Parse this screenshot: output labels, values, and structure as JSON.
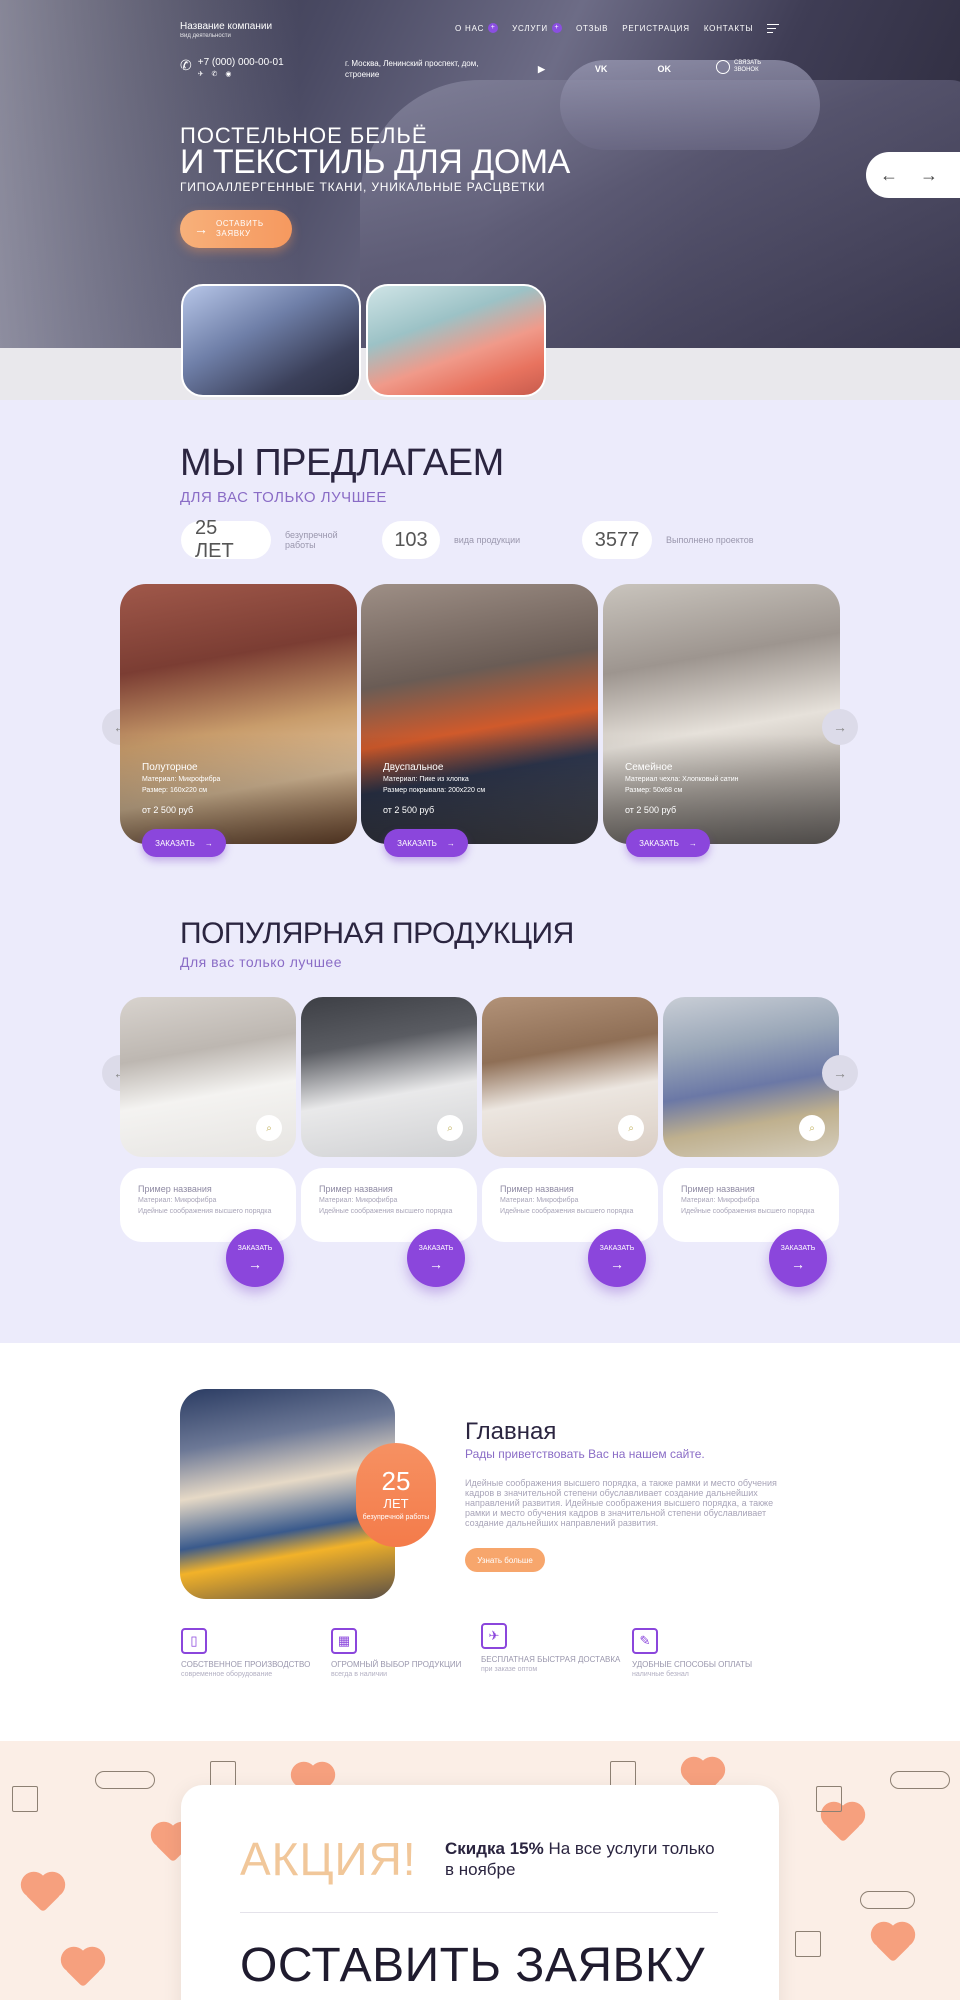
{
  "header": {
    "company_name": "Название компании",
    "company_sub": "Вид деятельности",
    "nav": [
      {
        "label": "О НАС",
        "has_dropdown": true
      },
      {
        "label": "УСЛУГИ",
        "has_dropdown": true
      },
      {
        "label": "ОТЗЫВ",
        "has_dropdown": false
      },
      {
        "label": "РЕГИСТРАЦИЯ",
        "has_dropdown": false
      },
      {
        "label": "КОНТАКТЫ",
        "has_dropdown": false
      }
    ],
    "dropdown_glyph": "+",
    "phone": "+7 (000) 000-00-01",
    "messengers": "✈ ✆ ◉",
    "address": "г. Москва, Ленинский проспект, дом, строение",
    "socials": [
      "▶",
      "VK",
      "OK"
    ],
    "call_me": "СВЯЗАТЬ ЗВОНОК"
  },
  "hero": {
    "title_line1": "ПОСТЕЛЬНОЕ БЕЛЬЁ",
    "title_line2": "И ТЕКСТИЛЬ ДЛЯ ДОМА",
    "subtitle": "ГИПОАЛЛЕРГЕННЫЕ ТКАНИ, УНИКАЛЬНЫЕ РАСЦВЕТКИ",
    "cta_line1": "ОСТАВИТЬ",
    "cta_line2": "ЗАЯВКУ",
    "arrow_prev": "←",
    "arrow_next": "→"
  },
  "offer": {
    "title": "МЫ ПРЕДЛАГАЕМ",
    "subtitle": "ДЛЯ ВАС ТОЛЬКО ЛУЧШЕЕ",
    "stats": [
      {
        "value": "25 ЛЕТ",
        "label": "безупречной работы"
      },
      {
        "value": "103",
        "label": "вида продукции"
      },
      {
        "value": "3577",
        "label": "Выполнено проектов"
      }
    ],
    "cards": [
      {
        "title": "Полуторное",
        "line1": "Материал: Микрофибра",
        "line2": "Размер: 160х220 см",
        "price": "от 2 500 руб",
        "button": "ЗАКАЗАТЬ"
      },
      {
        "title": "Двуспальное",
        "line1": "Материал: Пике из хлопка",
        "line2": "Размер покрывала: 200х220 см",
        "price": "от 2 500 руб",
        "button": "ЗАКАЗАТЬ"
      },
      {
        "title": "Семейное",
        "line1": "Материал чехла: Хлопковый сатин",
        "line2": "Размер: 50х68 см",
        "price": "от 2 500 руб",
        "button": "ЗАКАЗАТЬ"
      }
    ],
    "arrow_prev": "←",
    "arrow_next": "→",
    "button_arrow": "→"
  },
  "popular": {
    "title": "ПОПУЛЯРНАЯ ПРОДУКЦИЯ",
    "subtitle": "Для вас только лучшее",
    "products": [
      {
        "name": "Пример названия",
        "material": "Материал: Микрофибра",
        "desc": "Идейные соображения высшего порядка",
        "button": "ЗАКАЗАТЬ"
      },
      {
        "name": "Пример названия",
        "material": "Материал: Микрофибра",
        "desc": "Идейные соображения высшего порядка",
        "button": "ЗАКАЗАТЬ"
      },
      {
        "name": "Пример названия",
        "material": "Материал: Микрофибра",
        "desc": "Идейные соображения высшего порядка",
        "button": "ЗАКАЗАТЬ"
      },
      {
        "name": "Пример названия",
        "material": "Материал: Микрофибра",
        "desc": "Идейные соображения высшего порядка",
        "button": "ЗАКАЗАТЬ"
      }
    ],
    "zoom_glyph": "⌕",
    "arrow_prev": "←",
    "arrow_next": "→",
    "button_arrow": "→"
  },
  "about": {
    "years_value": "25",
    "years_unit": "ЛЕТ",
    "years_note": "безупречной работы",
    "title": "Главная",
    "subtitle": "Рады приветствовать Вас на нашем сайте.",
    "text": "Идейные соображения высшего порядка, а также рамки и место обучения кадров в значительной степени обуславливает создание дальнейших направлений развития. Идейные соображения высшего порядка, а также рамки и место обучения кадров в значительной степени обуславливает создание дальнейших направлений развития.",
    "button": "Узнать больше",
    "features": [
      {
        "icon": "factory-icon",
        "glyph": "▯",
        "title": "СОБСТВЕННОЕ ПРОИЗВОДСТВО",
        "sub": "современное оборудование"
      },
      {
        "icon": "catalog-icon",
        "glyph": "▦",
        "title": "ОГРОМНЫЙ ВЫБОР ПРОДУКЦИИ",
        "sub": "всегда в наличии"
      },
      {
        "icon": "delivery-icon",
        "glyph": "✈",
        "title": "БЕСПЛАТНАЯ БЫСТРАЯ ДОСТАВКА",
        "sub": "при заказе оптом"
      },
      {
        "icon": "feather-icon",
        "glyph": "✎",
        "title": "УДОБНЫЕ СПОСОБЫ ОПЛАТЫ",
        "sub": "наличные безнал"
      }
    ]
  },
  "promo": {
    "word": "АКЦИЯ!",
    "discount_bold": "Скидка 15%",
    "discount_rest": " На все услуги только в ноябре",
    "cta": "ОСТАВИТЬ ЗАЯВКУ"
  },
  "colors": {
    "accent_purple": "#8b46dc",
    "accent_orange": "#f6995f",
    "lavender_bg": "#ecebfb"
  }
}
